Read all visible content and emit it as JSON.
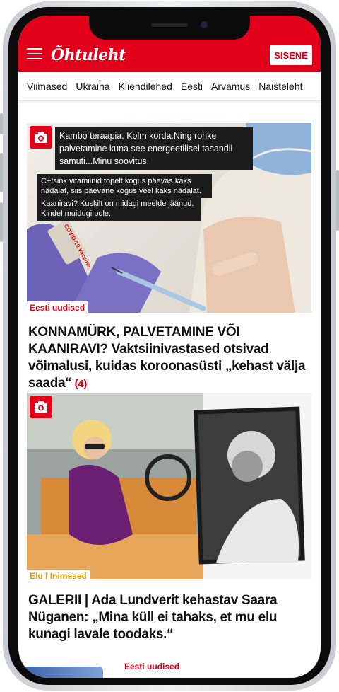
{
  "header": {
    "logo": "Õhtuleht",
    "login_label": "SISENE",
    "brand_color": "#e2001a"
  },
  "nav": {
    "items": [
      "Viimased",
      "Ukraina",
      "Kliendilehed",
      "Eesti",
      "Arvamus",
      "Naisteleht"
    ]
  },
  "articles": [
    {
      "icon": "camera-icon",
      "quotes": [
        "Kambo teraapia. Kolm korda.Ning rohke palvetamine kuna see energeetilisel tasandil samuti...Minu soovitus.",
        "C+tsink vitamiinid topelt kogus päevas kaks nädalat, siis päevane kogus veel kaks nädalat.",
        "Kaaniravi? Kuskilt on midagi meelde jäänud. Kindel muidugi pole."
      ],
      "vial_label": "COVID-19 Vaccine",
      "category": "Eesti uudised",
      "title": "KONNAMÜRK, PALVETAMINE VÕI KAANIRAVI? Vaktsiinivastased otsivad võimalusi, kuidas koroonasüsti „kehast välja saada“",
      "comments": "(4)"
    },
    {
      "icon": "camera-icon",
      "category": "Elu | Inimesed",
      "category_color": "#e5a100",
      "title": "GALERII | Ada Lundverit kehastav Saara Nüganen: „Mina küll ei tahaks, et mu elu kunagi lavale toodaks.“"
    },
    {
      "category": "Eesti uudised"
    }
  ]
}
